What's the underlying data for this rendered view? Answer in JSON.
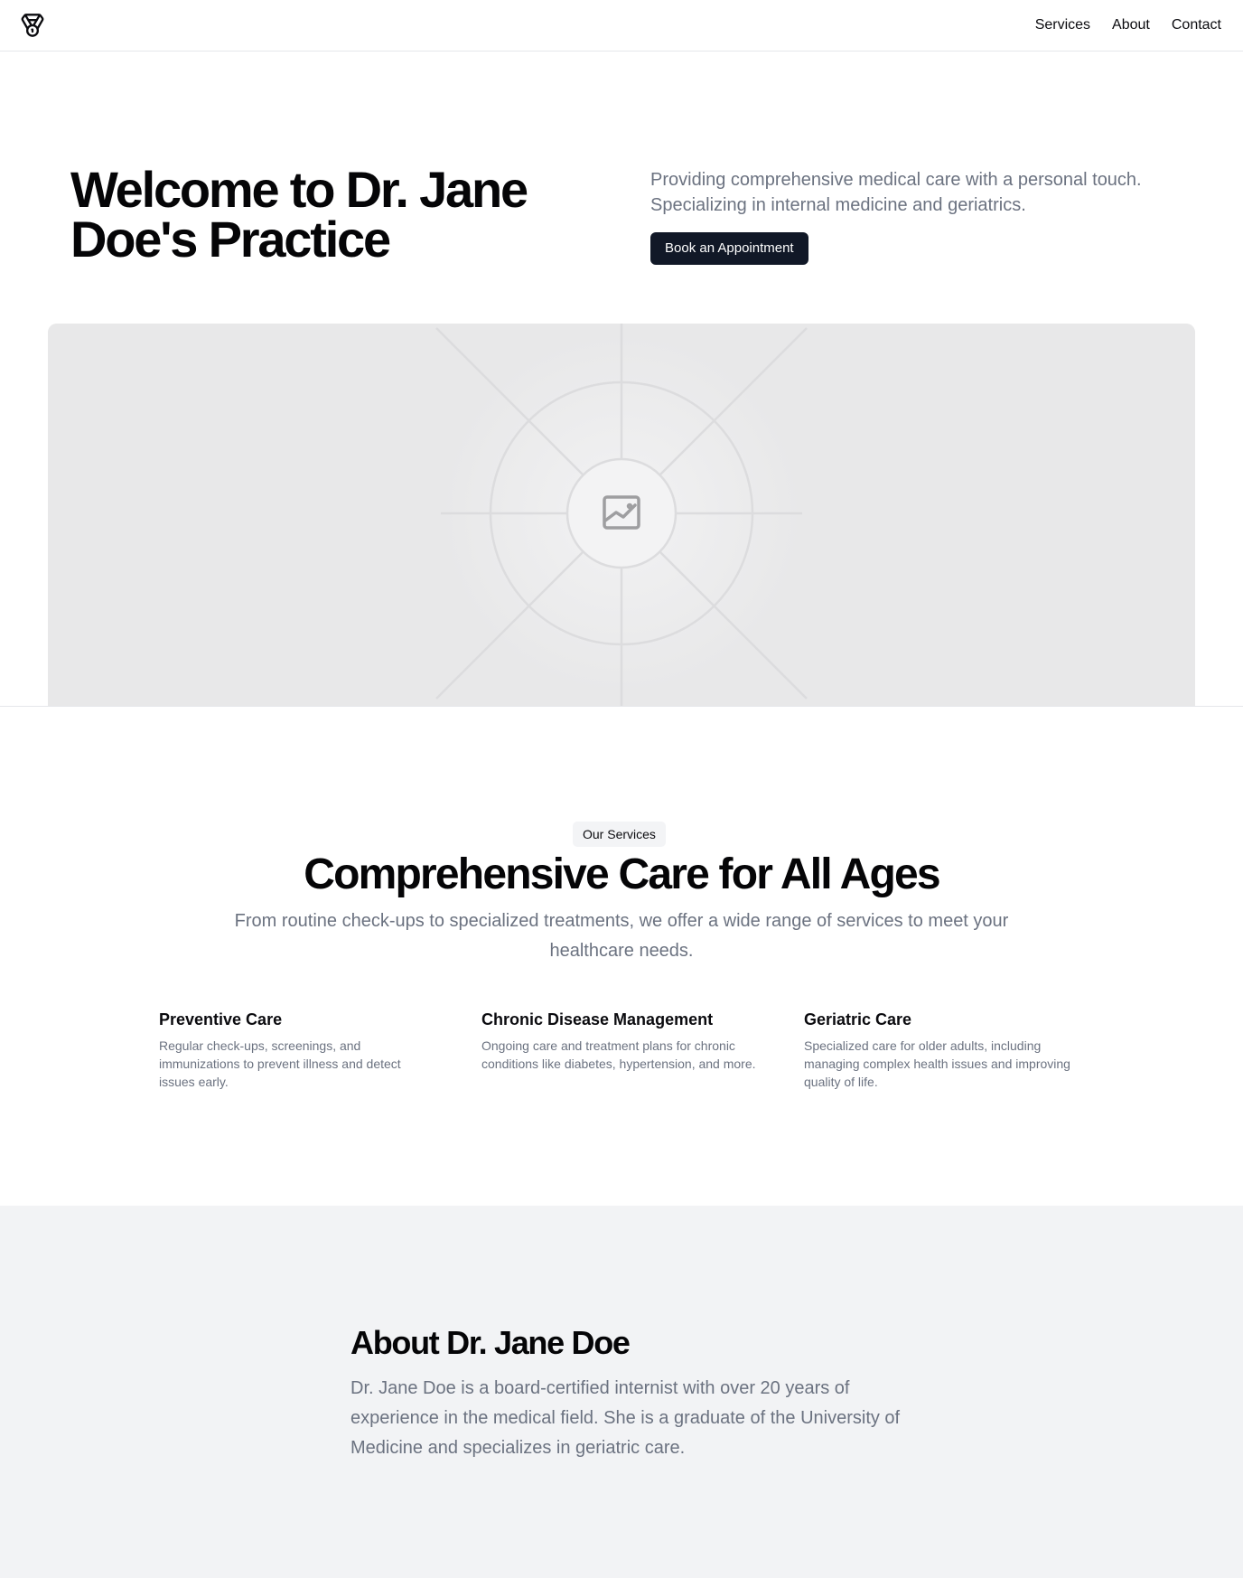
{
  "header": {
    "logo_icon": "medical-emblem-icon",
    "nav": [
      {
        "label": "Services"
      },
      {
        "label": "About"
      },
      {
        "label": "Contact"
      }
    ]
  },
  "hero": {
    "title": "Welcome to Dr. Jane Doe's Practice",
    "subtitle": "Providing comprehensive medical care with a personal touch. Specializing in internal medicine and geriatrics.",
    "cta_label": "Book an Appointment",
    "image_icon": "image-placeholder-icon"
  },
  "services": {
    "badge": "Our Services",
    "title": "Comprehensive Care for All Ages",
    "subtitle": "From routine check-ups to specialized treatments, we offer a wide range of services to meet your healthcare needs.",
    "items": [
      {
        "title": "Preventive Care",
        "description": "Regular check-ups, screenings, and immunizations to prevent illness and detect issues early."
      },
      {
        "title": "Chronic Disease Management",
        "description": "Ongoing care and treatment plans for chronic conditions like diabetes, hypertension, and more."
      },
      {
        "title": "Geriatric Care",
        "description": "Specialized care for older adults, including managing complex health issues and improving quality of life."
      }
    ]
  },
  "about": {
    "title": "About Dr. Jane Doe",
    "text": "Dr. Jane Doe is a board-certified internist with over 20 years of experience in the medical field. She is a graduate of the University of Medicine and specializes in geriatric care."
  },
  "colors": {
    "primary_button": "#111827",
    "muted_text": "#6b7280",
    "about_background": "#f2f3f5",
    "placeholder_background": "#e8e8e9"
  }
}
